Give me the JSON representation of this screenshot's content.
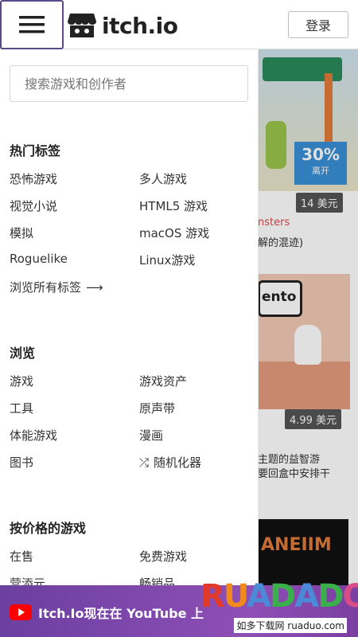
{
  "header": {
    "logo_text": "itch.io",
    "login_label": "登录"
  },
  "drawer": {
    "search_placeholder": "搜索游戏和创作者",
    "sections": {
      "tags": {
        "title": "热门标签",
        "col1": [
          "恐怖游戏",
          "视觉小说",
          "模拟",
          "Roguelike"
        ],
        "col2": [
          "多人游戏",
          "HTML5 游戏",
          "macOS 游戏",
          "Linux游戏"
        ],
        "browse_all": "浏览所有标签"
      },
      "browse": {
        "title": "浏览",
        "col1": [
          "游戏",
          "工具",
          "体能游戏",
          "图书"
        ],
        "col2": [
          "游戏资产",
          "原声带",
          "漫画",
          "随机化器"
        ]
      },
      "price": {
        "title": "按价格的游戏",
        "col1": [
          "在售",
          "营添元"
        ],
        "col2": [
          "免费游戏",
          "畅销品"
        ]
      }
    }
  },
  "background": {
    "discount_pct": "30%",
    "discount_sub": "离开",
    "price_1": "14 美元",
    "red_text": "nsters",
    "text_1": "解的混迹)",
    "panel_text": "ento",
    "price_2": "4.99 美元",
    "text_2": "主题的益智游",
    "text_3": "要回盒中安排干",
    "img3_text": "ANEIIM"
  },
  "bottom_banner": {
    "text": "Itch.Io现在在 YouTube 上"
  },
  "watermark": {
    "logo": "RUADADO",
    "sub": "如多下载网 ruaduo.com"
  },
  "colors": {
    "accent": "#5a4a8a",
    "banner": "#7a3fa0",
    "youtube": "#ff0000"
  }
}
